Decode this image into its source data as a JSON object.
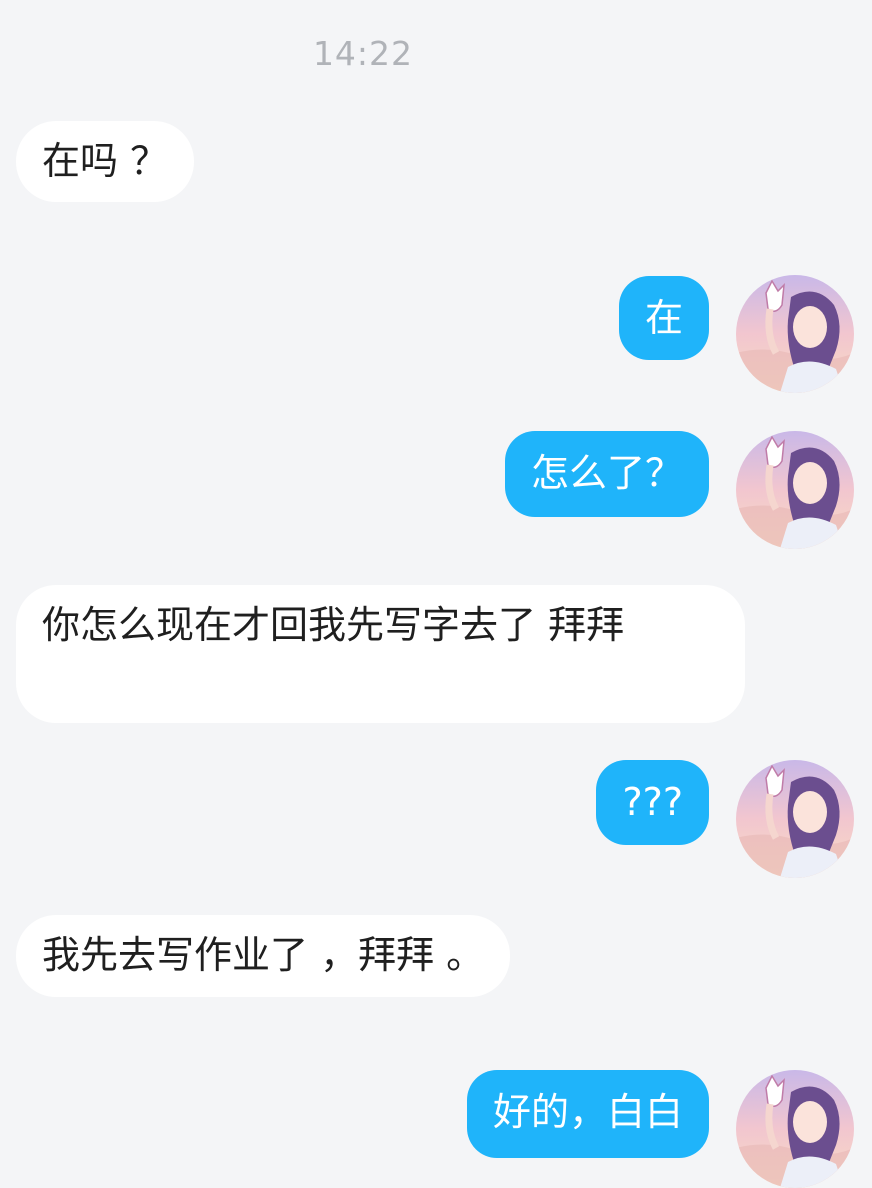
{
  "chat": {
    "timestamp": "14:22",
    "messages": [
      {
        "side": "incoming",
        "text": "在吗 ？"
      },
      {
        "side": "outgoing",
        "text": "在"
      },
      {
        "side": "outgoing",
        "text": "怎么了？"
      },
      {
        "side": "incoming",
        "text": "你怎么现在才回我先写字去了 拜拜"
      },
      {
        "side": "outgoing",
        "text": "???"
      },
      {
        "side": "incoming",
        "text": "我先去写作业了 ，拜拜 。"
      },
      {
        "side": "outgoing",
        "text": "好的，白白"
      }
    ]
  },
  "theme": {
    "background": "#f4f5f7",
    "incoming_bubble": "#ffffff",
    "outgoing_bubble": "#1fb4fa",
    "timestamp_color": "#b0b3b8"
  },
  "avatar": {
    "icon": "anime-girl-avatar-icon"
  }
}
